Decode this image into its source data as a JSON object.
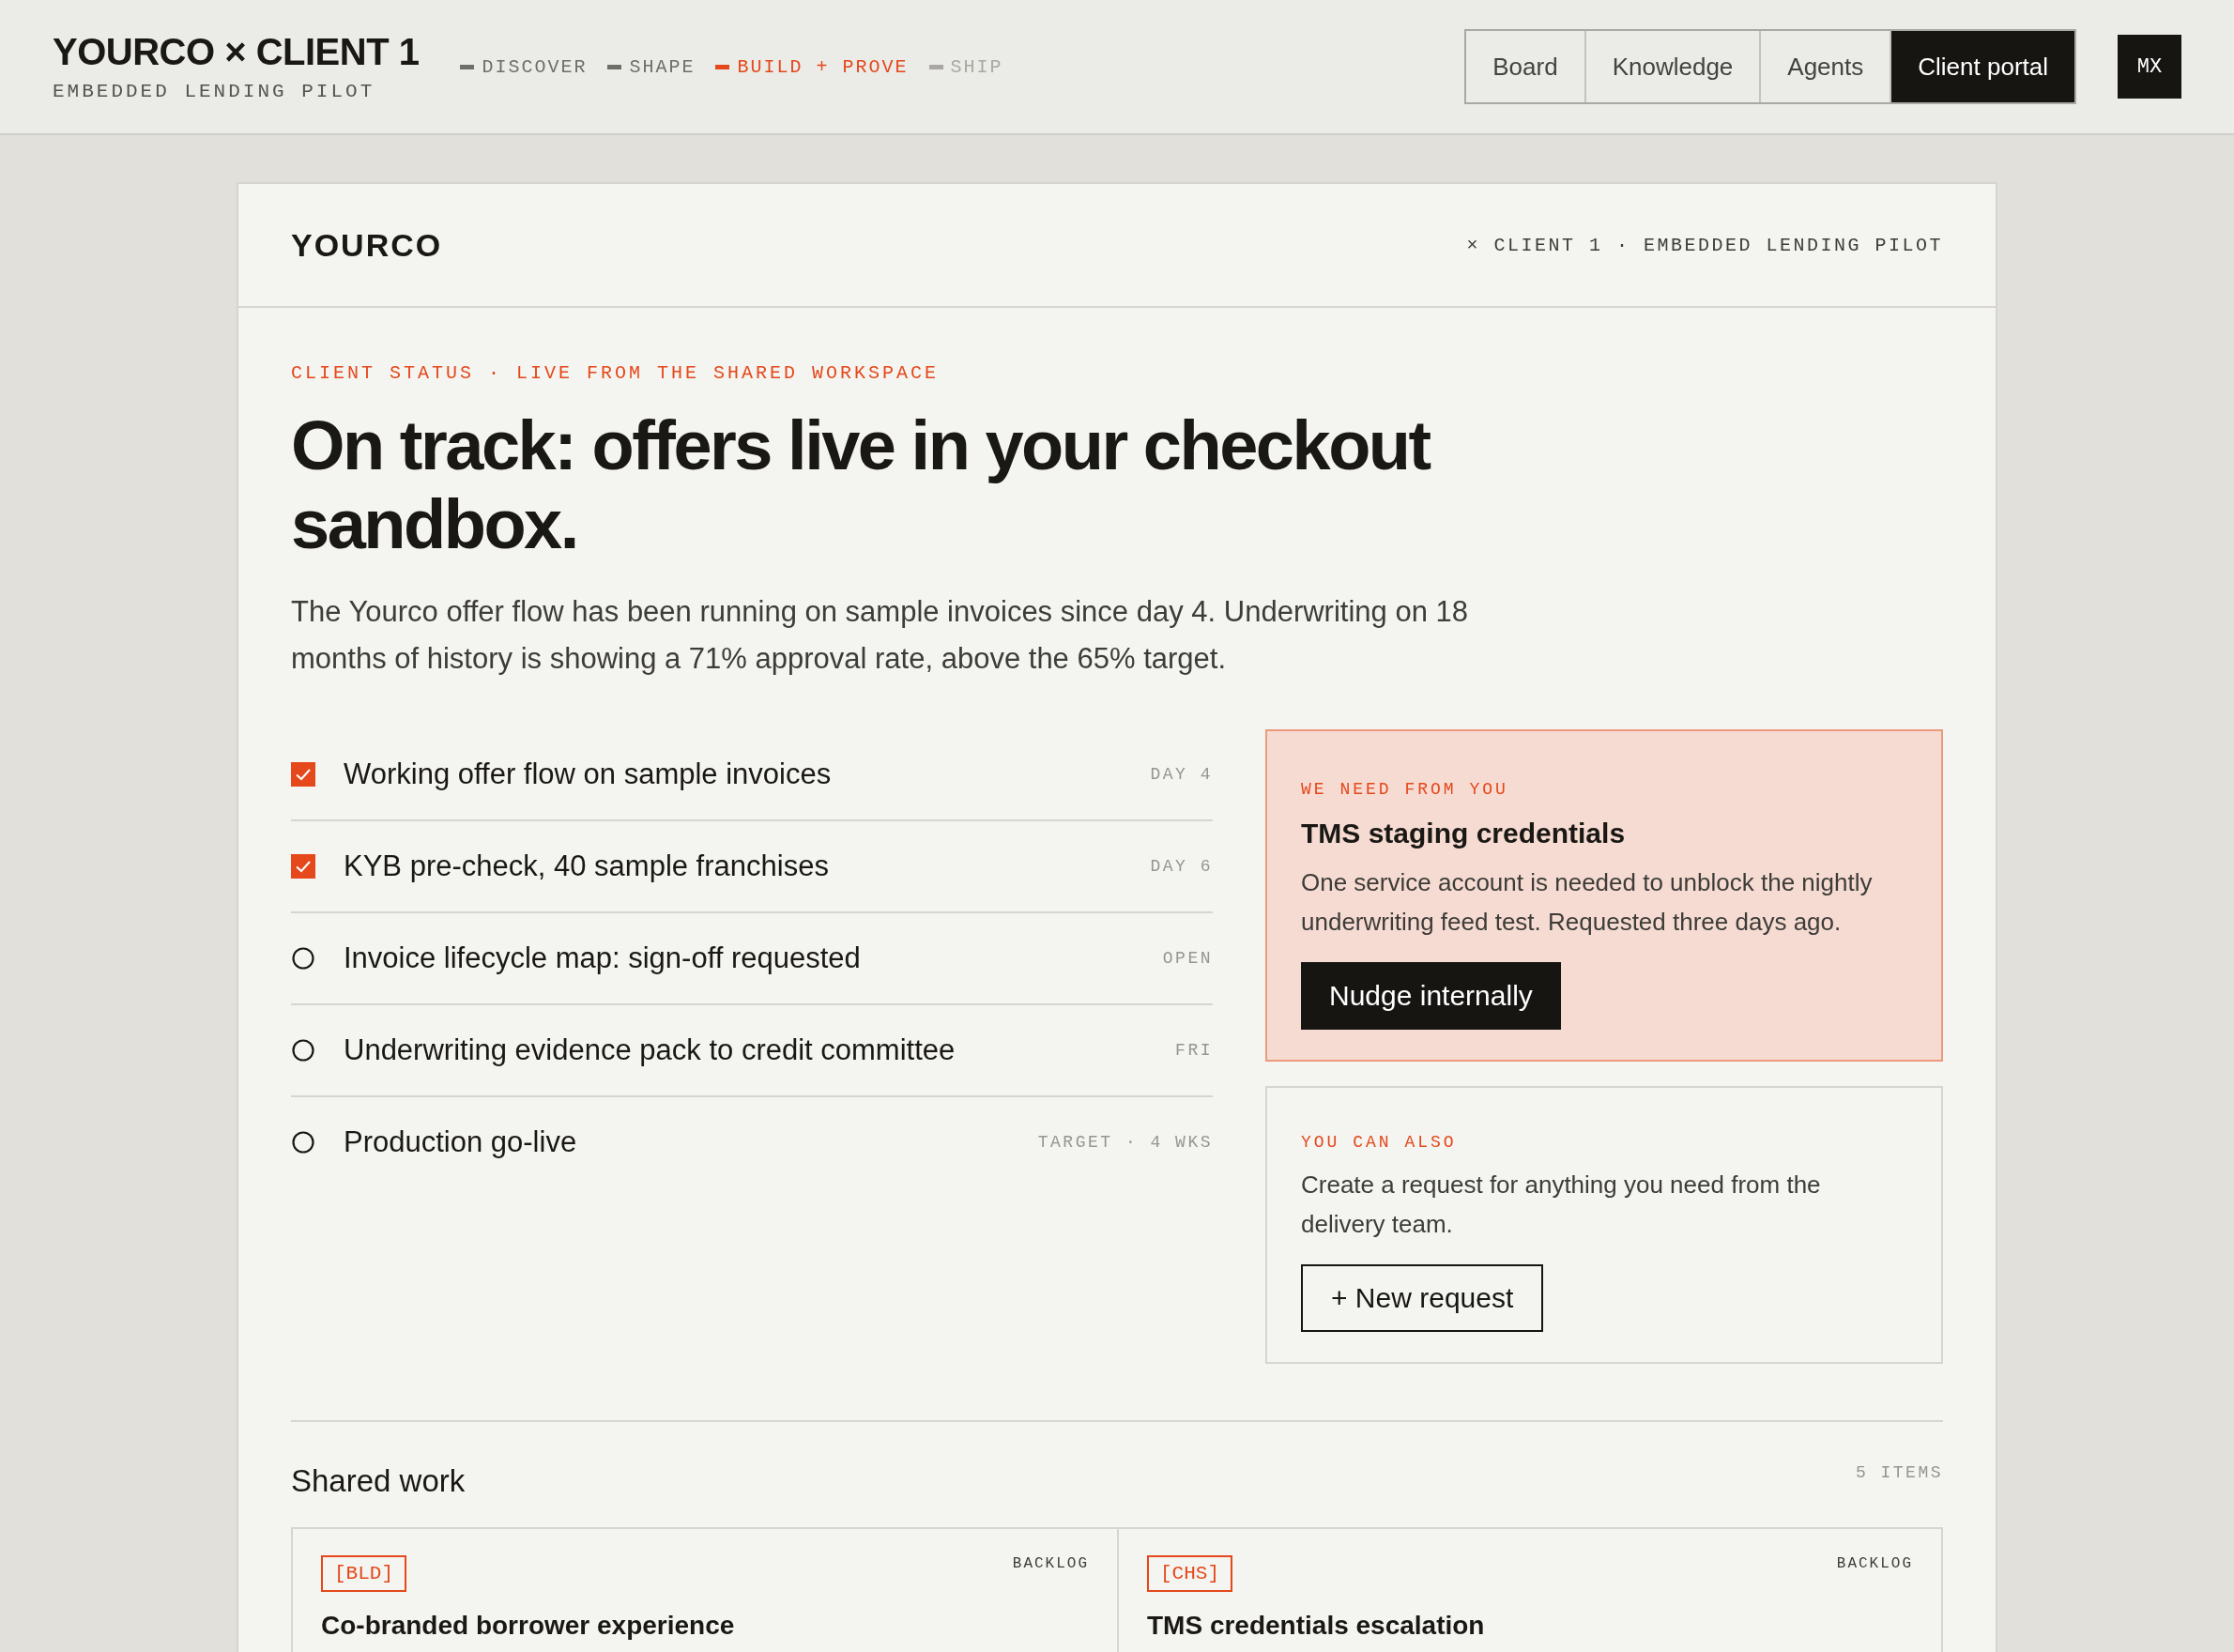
{
  "topbar": {
    "title": "YOURCO × CLIENT 1",
    "subtitle": "EMBEDDED LENDING PILOT",
    "phases": [
      {
        "label": "DISCOVER",
        "kind": "done"
      },
      {
        "label": "SHAPE",
        "kind": "done"
      },
      {
        "label": "BUILD + PROVE",
        "kind": "current"
      },
      {
        "label": "SHIP",
        "kind": "upcoming"
      }
    ],
    "tabs": [
      {
        "label": "Board",
        "selected": false
      },
      {
        "label": "Knowledge",
        "selected": false
      },
      {
        "label": "Agents",
        "selected": false
      },
      {
        "label": "Client portal",
        "selected": true
      }
    ],
    "avatar": "MX"
  },
  "portal": {
    "brand": "YOURCO",
    "context": "× CLIENT 1 · EMBEDDED LENDING PILOT",
    "eyebrow": "CLIENT STATUS · LIVE FROM THE SHARED WORKSPACE",
    "headline": "On track: offers live in your checkout sandbox.",
    "summary": "The Yourco offer flow has been running on sample invoices since day 4. Underwriting on 18 months of history is showing a 71% approval rate, above the 65% target.",
    "milestones": [
      {
        "label": "Working offer flow on sample invoices",
        "checked": true,
        "when": "DAY 4"
      },
      {
        "label": "KYB pre-check, 40 sample franchises",
        "checked": true,
        "when": "DAY 6"
      },
      {
        "label": "Invoice lifecycle map: sign-off requested",
        "checked": false,
        "when": "OPEN"
      },
      {
        "label": "Underwriting evidence pack to credit committee",
        "checked": false,
        "when": "FRI"
      },
      {
        "label": "Production go-live",
        "checked": false,
        "when": "TARGET · 4 WKS"
      }
    ],
    "panels": [
      {
        "kind": "request",
        "eyebrow": "WE NEED FROM YOU",
        "title": "TMS staging credentials",
        "text": "One service account is needed to unblock the nightly underwriting feed test. Requested three days ago.",
        "button": "Nudge internally"
      },
      {
        "kind": "option",
        "eyebrow": "YOU CAN ALSO",
        "text": "Create a request for anything you need from the delivery team.",
        "button": "+ New request"
      }
    ],
    "shared_work": {
      "title": "Shared work",
      "count": "5 ITEMS",
      "items": [
        {
          "tag": "[BLD]",
          "status": "BACKLOG",
          "title": "Co-branded borrower experience"
        },
        {
          "tag": "[CHS]",
          "status": "BACKLOG",
          "title": "TMS credentials escalation"
        }
      ]
    }
  }
}
